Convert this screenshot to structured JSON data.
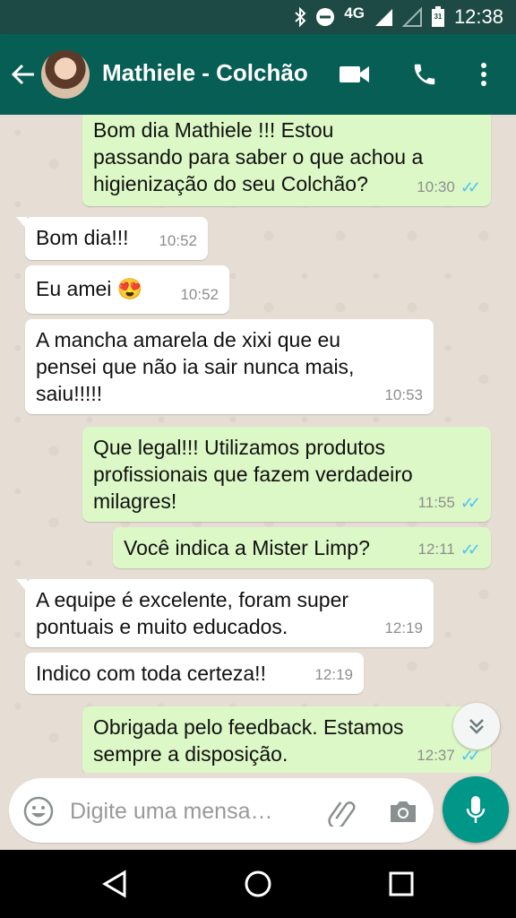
{
  "status_bar": {
    "network": "4G",
    "time": "12:38",
    "calendar_day": "31",
    "icons": [
      "bluetooth-icon",
      "do-not-disturb-icon",
      "signal-icon",
      "signal-empty-icon",
      "battery-icon"
    ]
  },
  "header": {
    "contact_name": "Mathiele - Colchão",
    "icons": [
      "back-arrow-icon",
      "video-call-icon",
      "phone-icon",
      "more-vert-icon"
    ]
  },
  "messages": [
    {
      "direction": "out",
      "text": "Bom dia Mathiele !!! Estou\npassando para saber o que achou a\nhigienização do seu Colchão?",
      "time": "10:30",
      "read": true
    },
    {
      "direction": "in",
      "text": "Bom dia!!!",
      "time": "10:52"
    },
    {
      "direction": "in",
      "text": "Eu amei 😍",
      "time": "10:52"
    },
    {
      "direction": "in",
      "text": "A mancha amarela de xixi que eu\npensei que não ia sair nunca mais,\nsaiu!!!!!",
      "time": "10:53"
    },
    {
      "direction": "out",
      "text": "Que legal!!! Utilizamos produtos\nprofissionais que fazem verdadeiro\nmilagres!",
      "time": "11:55",
      "read": true
    },
    {
      "direction": "out",
      "text": "Você indica a Mister Limp?",
      "time": "12:11",
      "read": true
    },
    {
      "direction": "in",
      "text": "A equipe é excelente, foram super\npontuais e muito educados.",
      "time": "12:19"
    },
    {
      "direction": "in",
      "text": "Indico com toda certeza!!",
      "time": "12:19"
    },
    {
      "direction": "out",
      "text": "Obrigada pelo feedback. Estamos\nsempre a disposição.",
      "time": "12:37",
      "read": true
    }
  ],
  "composer": {
    "placeholder": "Digite uma mensa…",
    "value": ""
  },
  "colors": {
    "header": "#075e54",
    "status_bar": "#1d4a44",
    "outgoing_bubble": "#dcf8c6",
    "incoming_bubble": "#ffffff",
    "read_ticks": "#4fc3f7",
    "mic_button": "#009688"
  }
}
